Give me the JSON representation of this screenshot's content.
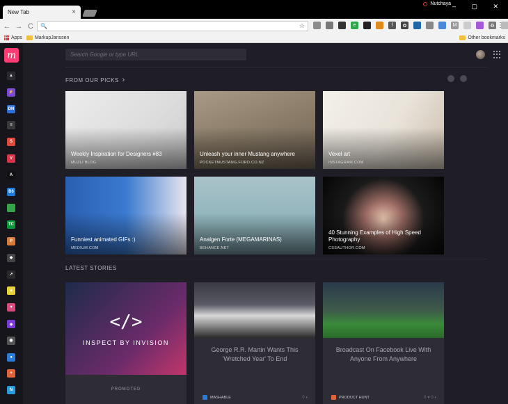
{
  "browser": {
    "tab_title": "New Tab",
    "tab_close": "×",
    "profile_name": "Nutchaya",
    "window_controls": "– ▢ ✕",
    "nav_back": "←",
    "nav_forward": "→",
    "nav_reload": "C",
    "omnibox_icon": "🔍",
    "star": "☆",
    "menu": "⋮",
    "bookmarks": {
      "apps": "Apps",
      "folder": "MarkupJanssen",
      "other": "Other bookmarks"
    },
    "extensions": [
      {
        "name": "ext-1",
        "color": "#8c8c8c",
        "text": ""
      },
      {
        "name": "ext-2",
        "color": "#777777",
        "text": ""
      },
      {
        "name": "ext-3",
        "color": "#333333",
        "text": ""
      },
      {
        "name": "ext-4",
        "color": "#2aa84a",
        "text": "e"
      },
      {
        "name": "ext-5",
        "color": "#222222",
        "text": ""
      },
      {
        "name": "ext-6",
        "color": "#e08a1e",
        "text": ""
      },
      {
        "name": "ext-7",
        "color": "#555555",
        "text": "f"
      },
      {
        "name": "ext-8",
        "color": "#444444",
        "text": "✿"
      },
      {
        "name": "ext-9",
        "color": "#2266aa",
        "text": ""
      },
      {
        "name": "ext-10",
        "color": "#888888",
        "text": ""
      },
      {
        "name": "ext-11",
        "color": "#4a88d8",
        "text": ""
      },
      {
        "name": "ext-12",
        "color": "#999999",
        "text": "M"
      },
      {
        "name": "ext-13",
        "color": "#cccccc",
        "text": ""
      },
      {
        "name": "ext-14",
        "color": "#a45ad8",
        "text": ""
      },
      {
        "name": "ext-15",
        "color": "#777777",
        "text": "♻"
      },
      {
        "name": "ext-16",
        "color": "#bbbbbb",
        "text": ""
      }
    ]
  },
  "sidebar": {
    "logo": "m",
    "items": [
      {
        "name": "sidebar-item-1",
        "label": "▲",
        "color": "#2b2a33"
      },
      {
        "name": "sidebar-item-2",
        "label": "⚡",
        "color": "#7a4ad8"
      },
      {
        "name": "sidebar-item-dn",
        "label": "DN",
        "color": "#2f6fd8"
      },
      {
        "name": "sidebar-item-4",
        "label": "≡",
        "color": "#3a3a3a"
      },
      {
        "name": "sidebar-item-5",
        "label": "S",
        "color": "#e0493a"
      },
      {
        "name": "sidebar-item-6",
        "label": "V",
        "color": "#d8344a"
      },
      {
        "name": "sidebar-item-7",
        "label": "A",
        "color": "#111111"
      },
      {
        "name": "sidebar-item-8",
        "label": "B6",
        "color": "#1e7ad8"
      },
      {
        "name": "sidebar-item-9",
        "label": "",
        "color": "#38a44a"
      },
      {
        "name": "sidebar-item-tc",
        "label": "TC",
        "color": "#0a9a3a"
      },
      {
        "name": "sidebar-item-p",
        "label": "P",
        "color": "#d87a3a"
      },
      {
        "name": "sidebar-item-12",
        "label": "◆",
        "color": "#444444"
      },
      {
        "name": "sidebar-item-13",
        "label": "↗",
        "color": "#2a2a2a"
      },
      {
        "name": "sidebar-item-14",
        "label": "▲",
        "color": "#e8d43a"
      },
      {
        "name": "sidebar-item-15",
        "label": "♥",
        "color": "#d84a7a"
      },
      {
        "name": "sidebar-item-16",
        "label": "◈",
        "color": "#7a3ad8"
      },
      {
        "name": "sidebar-item-17",
        "label": "◉",
        "color": "#555555"
      },
      {
        "name": "sidebar-item-18",
        "label": "●",
        "color": "#2a7ad8"
      },
      {
        "name": "sidebar-item-19",
        "label": "+",
        "color": "#e0643a"
      },
      {
        "name": "sidebar-item-20",
        "label": "N",
        "color": "#2a9ad8"
      }
    ]
  },
  "main": {
    "search_placeholder": "Search Google or type URL",
    "picks_title": "FROM OUR PICKS",
    "picks_chevron": "›",
    "latest_title": "LATEST STORIES",
    "picks": [
      {
        "title": "Weekly Inspiration for Designers #83",
        "source": "MUZLI BLOG",
        "bg": "linear-gradient(135deg,#ececec 0%,#dcdcdc 60%,#c9c9c9 100%)"
      },
      {
        "title": "Unleash your inner Mustang anywhere",
        "source": "POCKETMUSTANG.FORD.CO.NZ",
        "bg": "linear-gradient(160deg,#a89a86 0%,#8a7c68 50%,#6f6354 100%)"
      },
      {
        "title": "Vexel art",
        "source": "INSTAGRAM.COM",
        "bg": "linear-gradient(120deg,#f3f0ea 0%,#e9e3da 55%,#cbbfae 100%)"
      },
      {
        "title": "Funniest animated GIFs :)",
        "source": "MEDIUM.COM",
        "bg": "linear-gradient(90deg,#2a5fb0 0%,#3a7ad0 50%,#e9e6ef 100%)"
      },
      {
        "title": "Analgen Forte (MEGAMARINAS)",
        "source": "BEHANCE.NET",
        "bg": "linear-gradient(180deg,#a9c3c9 0%,#8fb3ba 60%,#6e8f97 100%)"
      },
      {
        "title": "40 Stunning Examples of High Speed Photography",
        "source": "CSSAUTHOR.COM",
        "bg": "radial-gradient(circle at 50% 55%,#e8c7b0 0%,#9a6a62 25%,#1a1a1a 55%,#050505 100%)"
      }
    ],
    "stories": [
      {
        "title": "",
        "badge_text": "INSPECT BY INVISION",
        "tag": "PROMOTED",
        "bg": "linear-gradient(135deg,#1e2b4a 0%,#6a2b6a 55%,#e23a6a 100%)"
      },
      {
        "title": "George R.R. Martin Wants This 'Wretched Year' To End",
        "source": "MASHABLE",
        "source_color": "#2a7ad8",
        "counts": "0 ◐",
        "bg": "linear-gradient(180deg,#3a3a44 0%,#5a5a66 40%,#d8d8d8 60%,#2a2a2a 100%)"
      },
      {
        "title": "Broadcast On Facebook Live With Anyone From Anywhere",
        "source": "PRODUCT HUNT",
        "source_color": "#e0643a",
        "counts": "0 ♥  0 ◐",
        "bg": "linear-gradient(180deg,#2a3a4a 0%,#3e5a4a 50%,#3a8a3a 75%,#2a6a2a 100%)"
      }
    ]
  }
}
